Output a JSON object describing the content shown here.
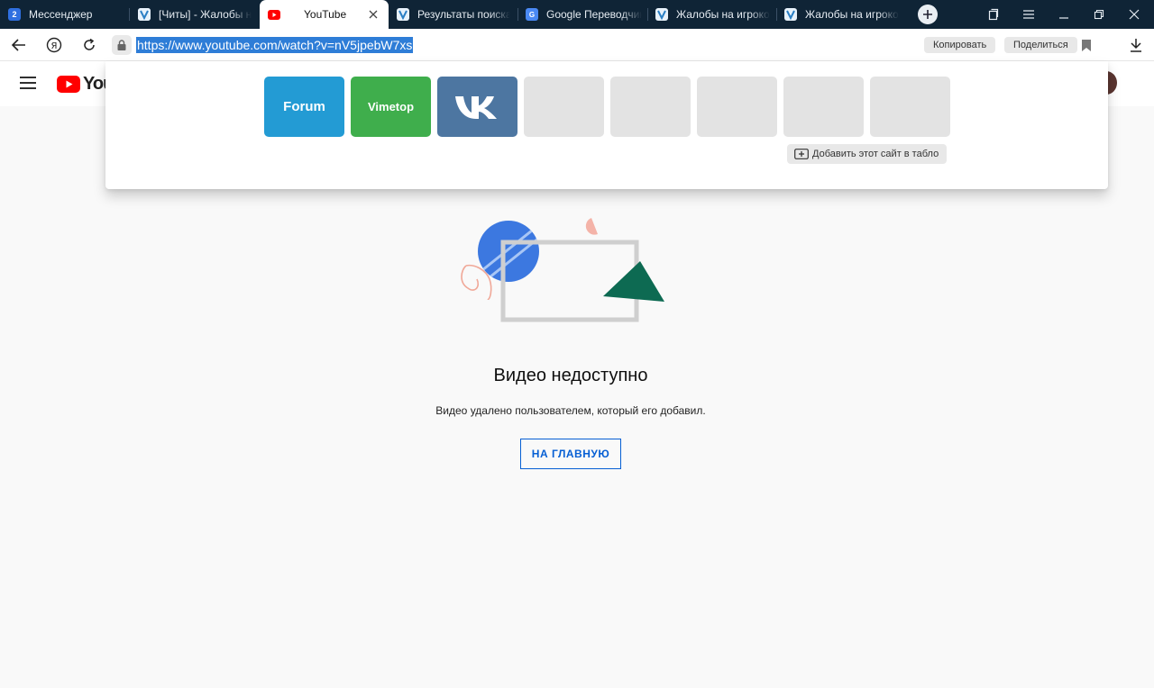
{
  "tabs": [
    {
      "title": "Мессенджер",
      "icon": "messenger-icon",
      "badge": "2",
      "active": false
    },
    {
      "title": "[Читы] - Жалобы на",
      "icon": "vimetop-forum-icon",
      "active": false
    },
    {
      "title": "YouTube",
      "icon": "youtube-icon",
      "active": true
    },
    {
      "title": "Результаты поиска",
      "icon": "vimetop-forum-icon",
      "active": false
    },
    {
      "title": "Google Переводчик",
      "icon": "google-translate-icon",
      "active": false
    },
    {
      "title": "Жалобы на игроков",
      "icon": "vimetop-forum-icon",
      "active": false
    },
    {
      "title": "Жалобы на игроков",
      "icon": "vimetop-forum-icon",
      "active": false
    }
  ],
  "toolbar": {
    "url": "https://www.youtube.com/watch?v=nV5jpebW7xs",
    "copy_label": "Копировать",
    "share_label": "Поделиться"
  },
  "tableau": {
    "tiles": [
      {
        "label": "Forum",
        "color": "#239bd4"
      },
      {
        "label": "Vimetop",
        "color": "#3fae4c"
      },
      {
        "label": "",
        "color": "#4d76a1",
        "icon": "vk-icon"
      },
      {
        "label": "",
        "color": "#e3e3e3"
      },
      {
        "label": "",
        "color": "#e3e3e3"
      },
      {
        "label": "",
        "color": "#e3e3e3"
      },
      {
        "label": "",
        "color": "#e3e3e3"
      },
      {
        "label": "",
        "color": "#e3e3e3"
      }
    ],
    "add_site_label": "Добавить этот сайт в табло"
  },
  "youtube": {
    "logo_text": "YouT",
    "error_title": "Видео недоступно",
    "error_description": "Видео удалено пользователем, который его добавил.",
    "home_button": "НА ГЛАВНУЮ"
  },
  "colors": {
    "accent": "#065fd4",
    "url_highlight": "#2e7dd7",
    "tab_strip": "#0f2436"
  }
}
